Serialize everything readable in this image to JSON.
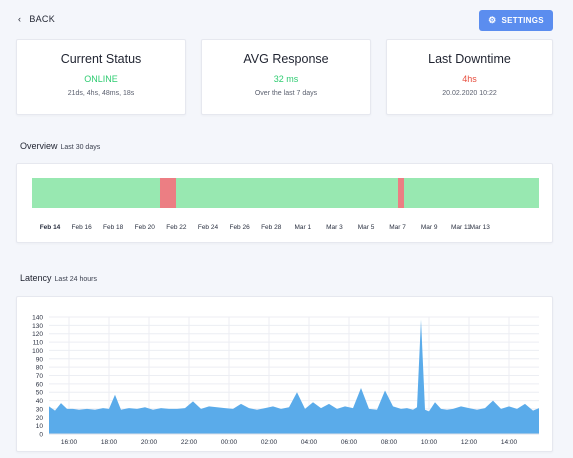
{
  "header": {
    "back_label": "BACK",
    "settings_label": "SETTINGS"
  },
  "stats": [
    {
      "title": "Current Status",
      "value": "ONLINE",
      "sub": "21ds, 4hs, 48ms, 18s",
      "color": "#2ecc71"
    },
    {
      "title": "AVG Response",
      "value": "32 ms",
      "sub": "Over the last 7 days",
      "color": "#2ecc71"
    },
    {
      "title": "Last Downtime",
      "value": "4hs",
      "sub": "20.02.2020 10:22",
      "color": "#e74c3c"
    }
  ],
  "overview": {
    "title": "Overview",
    "subtitle": "Last 30 days",
    "colors": {
      "up": "#98e8b1",
      "down": "#ec7e83"
    },
    "dates": [
      "Feb 14",
      "Feb 16",
      "Feb 18",
      "Feb 20",
      "Feb 22",
      "Feb 24",
      "Feb 26",
      "Feb 28",
      "Mar 1",
      "Mar 3",
      "Mar 5",
      "Mar 7",
      "Mar 9",
      "Mar 11",
      "Mar 13"
    ],
    "date_positions": [
      0.0,
      0.0667,
      0.1333,
      0.2,
      0.2667,
      0.3333,
      0.4,
      0.4667,
      0.5333,
      0.6,
      0.6667,
      0.7333,
      0.8,
      0.8667,
      0.9067
    ],
    "downtime_fraction_ranges": [
      [
        0.252,
        0.285
      ],
      [
        0.721,
        0.733
      ]
    ]
  },
  "latency": {
    "title": "Latency",
    "subtitle": "Last 24 hours",
    "chart_data": {
      "type": "area",
      "x_ticks": [
        "16:00",
        "18:00",
        "20:00",
        "22:00",
        "00:00",
        "02:00",
        "04:00",
        "06:00",
        "08:00",
        "10:00",
        "12:00",
        "14:00"
      ],
      "y_ticks": [
        0,
        10,
        20,
        30,
        40,
        50,
        60,
        70,
        80,
        90,
        100,
        110,
        120,
        130,
        140
      ],
      "ylim": [
        0,
        140
      ],
      "x_start_hour": 15,
      "x_end_hour": 39.5,
      "grid": true,
      "color": "#5aabea",
      "hours": [
        15,
        15.3,
        15.6,
        15.9,
        16.2,
        16.5,
        16.9,
        17.3,
        17.7,
        18.0,
        18.3,
        18.6,
        19.0,
        19.4,
        19.8,
        20.2,
        20.6,
        21.0,
        21.4,
        21.8,
        22.2,
        22.6,
        23.0,
        23.4,
        23.8,
        24.2,
        24.6,
        25.0,
        25.4,
        25.8,
        26.2,
        26.6,
        27.0,
        27.4,
        27.8,
        28.2,
        28.6,
        29.0,
        29.4,
        29.8,
        30.2,
        30.6,
        31.0,
        31.4,
        31.8,
        32.2,
        32.6,
        32.9,
        33.2,
        33.4,
        33.6,
        33.8,
        34.0,
        34.3,
        34.6,
        34.9,
        35.2,
        35.6,
        36.0,
        36.4,
        36.8,
        37.2,
        37.6,
        38.0,
        38.4,
        38.8,
        39.2,
        39.5
      ],
      "values": [
        33,
        28,
        37,
        30,
        30,
        29,
        30,
        29,
        31,
        30,
        47,
        29,
        31,
        30,
        32,
        29,
        31,
        30,
        30,
        31,
        39,
        30,
        33,
        32,
        31,
        30,
        36,
        31,
        29,
        31,
        33,
        30,
        32,
        50,
        30,
        38,
        31,
        36,
        30,
        33,
        31,
        55,
        30,
        29,
        52,
        33,
        30,
        31,
        29,
        32,
        137,
        29,
        27,
        38,
        30,
        29,
        30,
        33,
        31,
        29,
        31,
        40,
        30,
        33,
        30,
        36,
        28,
        31
      ]
    }
  }
}
